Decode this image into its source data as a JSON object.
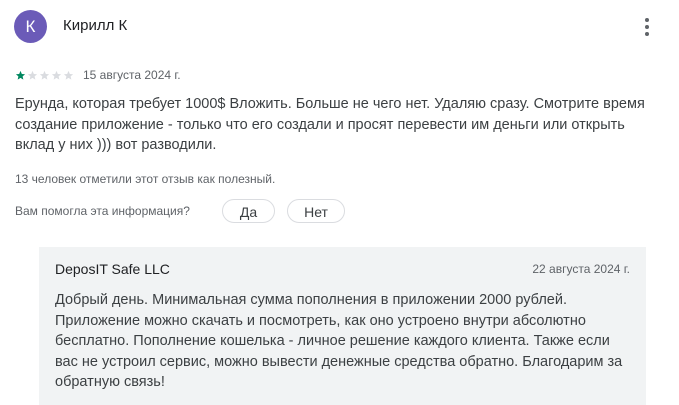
{
  "review": {
    "avatar_letter": "К",
    "avatar_color": "#6b5bb8",
    "author": "Кирилл К",
    "rating": 1,
    "rating_max": 5,
    "star_color_filled": "#01875f",
    "star_color_empty": "#dadce0",
    "date": "15 августа 2024 г.",
    "text": "Ерунда, которая требует 1000$ Вложить. Больше не чего нет. Удаляю сразу. Смотрите время создание приложение - только что его создали и просят перевести им деньги или открыть вклад у них ))) вот разводили.",
    "helpful_count_text": "13 человек отметили этот отзыв как полезный.",
    "helpful_question": "Вам помогла эта информация?",
    "vote_yes": "Да",
    "vote_no": "Нет",
    "more_icon": "more-vert-icon"
  },
  "developer_reply": {
    "name": "DeposIT Safe LLC",
    "date": "22 августа 2024 г.",
    "text": "Добрый день. Минимальная сумма пополнения в приложении 2000 рублей. Приложение можно скачать и посмотреть, как оно устроено внутри абсолютно бесплатно. Пополнение кошелька - личное решение каждого клиента. Также если вас не устроил сервис, можно вывести денежные средства обратно. Благодарим за обратную связь!"
  }
}
